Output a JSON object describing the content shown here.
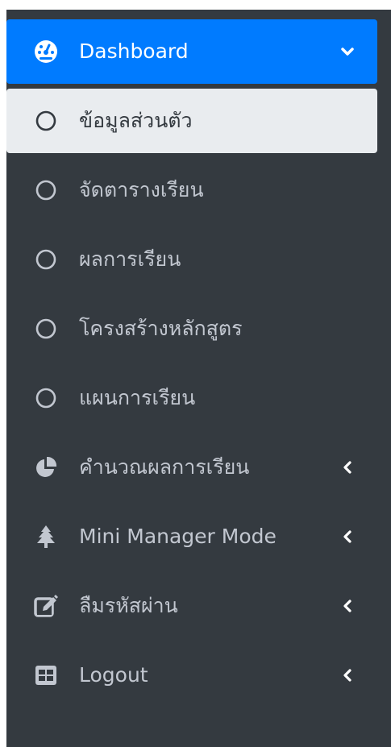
{
  "sidebar": {
    "items": [
      {
        "label": "Dashboard",
        "icon": "tachometer-icon",
        "chevron": "chevron-down-icon"
      },
      {
        "label": "ข้อมูลส่วนตัว",
        "icon": "circle-icon"
      },
      {
        "label": "จัดตารางเรียน",
        "icon": "circle-icon"
      },
      {
        "label": "ผลการเรียน",
        "icon": "circle-icon"
      },
      {
        "label": "โครงสร้างหลักสูตร",
        "icon": "circle-icon"
      },
      {
        "label": "แผนการเรียน",
        "icon": "circle-icon"
      },
      {
        "label": "คำนวณผลการเรียน",
        "icon": "pie-chart-icon",
        "chevron": "chevron-left-icon"
      },
      {
        "label": "Mini Manager Mode",
        "icon": "tree-icon",
        "chevron": "chevron-left-icon"
      },
      {
        "label": "ลืมรหัสผ่าน",
        "icon": "edit-icon",
        "chevron": "chevron-left-icon"
      },
      {
        "label": "Logout",
        "icon": "table-icon",
        "chevron": "chevron-left-icon"
      }
    ]
  },
  "colors": {
    "sidebar_bg": "#343a40",
    "active_bg": "#007bff",
    "sub_active_bg": "#e9ecef",
    "text": "#c2c7d0"
  }
}
